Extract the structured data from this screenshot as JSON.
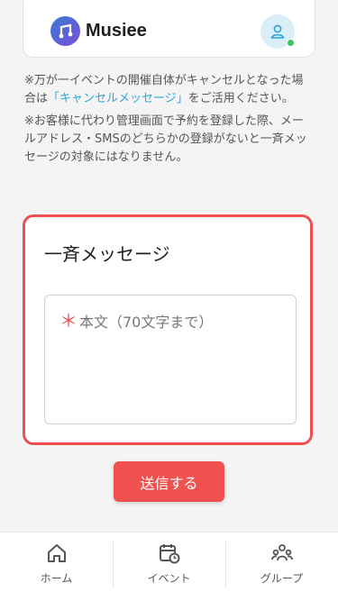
{
  "header": {
    "app_name": "Musiee",
    "logo_icon": "music-note-logo",
    "avatar_icon": "user-icon",
    "status_color": "#3cc55c"
  },
  "notes": {
    "note1_before": "※万が一イベントの開催自体がキャンセルとなった場合は",
    "note1_link": "「キャンセルメッセージ」",
    "note1_after": "をご活用ください。",
    "note2": "※お客様に代わり管理画面で予約を登録した際、メールアドレス・SMSのどちらかの登録がないと一斉メッセージの対象にはなりません。"
  },
  "card": {
    "title": "一斉メッセージ",
    "required_mark": "＊",
    "body_placeholder": "本文（70文字まで）",
    "border_color": "#ef4f52"
  },
  "send_button": {
    "label": "送信する",
    "color": "#f0524f"
  },
  "tabbar": {
    "items": [
      {
        "label": "ホーム",
        "icon": "home-icon"
      },
      {
        "label": "イベント",
        "icon": "calendar-clock-icon"
      },
      {
        "label": "グループ",
        "icon": "group-icon"
      }
    ]
  },
  "link_color": "#29a6dc"
}
